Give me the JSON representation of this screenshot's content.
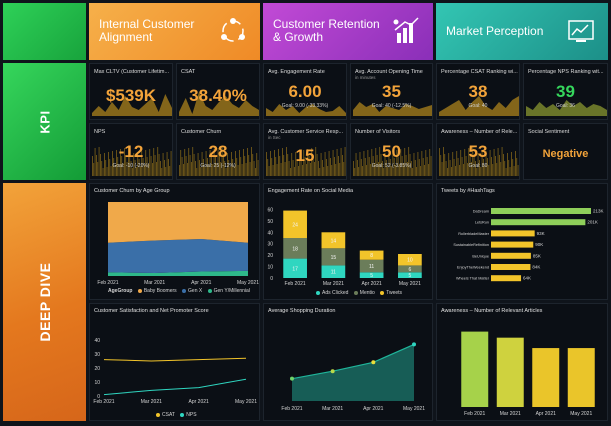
{
  "sections": {
    "kpi_label": "KPI",
    "deep_dive_label": "DEEP DIVE"
  },
  "banners": [
    {
      "label": "Internal Customer Alignment",
      "icon": "team-circle-icon",
      "color": "#ef8a26"
    },
    {
      "label": "Customer Retention & Growth",
      "icon": "growth-bars-icon",
      "color": "#8a2fb8"
    },
    {
      "label": "Market Perception",
      "icon": "chart-screen-icon",
      "color": "#1c8f88"
    }
  ],
  "kpis": [
    {
      "title": "Max CLTV (Customer Lifetim...",
      "value": "$539K",
      "goal": ""
    },
    {
      "title": "CSAT",
      "value": "38.40%",
      "goal": ""
    },
    {
      "title": "Avg. Engagement Rate",
      "value": "6.00",
      "goal": "Goal: 9.00 (-33.33%)"
    },
    {
      "title": "Avg. Account Opening Time",
      "subtitle": "in minutes",
      "value": "35",
      "goal": "Goal: 40 (-12.5%)"
    },
    {
      "title": "Percentage CSAT Ranking wi...",
      "value": "38",
      "goal": "Goal: 40"
    },
    {
      "title": "Percentage NPS Ranking wit...",
      "value": "39",
      "goal": "Goal: 36"
    },
    {
      "title": "NPS",
      "value": "-12",
      "goal": "Goal: -10 (-20%)"
    },
    {
      "title": "Customer Churn",
      "value": "28",
      "goal": "Goal: 25 (-12%)"
    },
    {
      "title": "Avg. Customer Service Resp...",
      "subtitle": "in Sec",
      "value": "15",
      "goal": ""
    },
    {
      "title": "Number of Visitors",
      "value": "50",
      "goal": "Goal: 52 (-3.85%)"
    },
    {
      "title": "Awareness – Number of Rele...",
      "value": "53",
      "goal": "Goal: 80"
    },
    {
      "title": "Social Sentiment",
      "value": "Negative",
      "goal": ""
    }
  ],
  "panels": {
    "churn_by_age": {
      "title": "Customer Churn by Age Group",
      "legend_title": "AgeGroup"
    },
    "engagement_social": {
      "title": "Engagement Rate on Social Media"
    },
    "tweets_hashtags": {
      "title": "Tweets by #HashTags"
    },
    "csat_nps": {
      "title": "Customer Satisfaction and Net Promoter Score"
    },
    "shopping_duration": {
      "title": "Average Shopping Duration"
    },
    "awareness_articles": {
      "title": "Awareness – Number of Relevant Articles"
    }
  },
  "chart_data": [
    {
      "id": "churn_by_age",
      "type": "area",
      "stacked": true,
      "categories": [
        "Feb 2021",
        "Mar 2021",
        "Apr 2021",
        "May 2021"
      ],
      "series": [
        {
          "name": "Baby Boomers",
          "color": "#f0a94a",
          "values": [
            55,
            52,
            50,
            55
          ]
        },
        {
          "name": "Gen X",
          "color": "#3a6fa8",
          "values": [
            40,
            44,
            44,
            38
          ]
        },
        {
          "name": "Gen Y/Millennial",
          "color": "#2eb88a",
          "values": [
            5,
            4,
            6,
            7
          ]
        }
      ]
    },
    {
      "id": "engagement_social",
      "type": "bar",
      "stacked": true,
      "categories": [
        "Feb 2021",
        "Mar 2021",
        "Apr 2021",
        "May 2021"
      ],
      "ylim": [
        0,
        70
      ],
      "yticks": [
        0,
        10,
        20,
        30,
        40,
        50,
        60
      ],
      "series": [
        {
          "name": "Ads Clicked",
          "color": "#2fd6c0",
          "values": [
            17,
            11,
            5,
            5
          ]
        },
        {
          "name": "Mentio",
          "color": "#6b7d5a",
          "values": [
            18,
            15,
            11,
            6
          ]
        },
        {
          "name": "Tweets",
          "color": "#f2c42a",
          "values": [
            24,
            14,
            8,
            10
          ]
        }
      ]
    },
    {
      "id": "tweets_hashtags",
      "type": "bar",
      "orientation": "horizontal",
      "categories": [
        "DaDream",
        "LetsRun",
        "RollerbladeMaster",
        "SustainableRefinition",
        "BeUnique",
        "EnjoyTheWeekend",
        "Wheels That Matter"
      ],
      "values": [
        213,
        201,
        93,
        90,
        85,
        84,
        64
      ],
      "labels": [
        "213K",
        "201K",
        "93K",
        "90K",
        "85K",
        "84K",
        "64K"
      ],
      "colors": [
        "#8fcf5a",
        "#8fcf5a",
        "#f2c42a",
        "#f2c42a",
        "#f2c42a",
        "#f2c42a",
        "#f2c42a"
      ]
    },
    {
      "id": "csat_nps",
      "type": "line",
      "categories": [
        "Feb 2021",
        "Mar 2021",
        "Apr 2021",
        "May 2021"
      ],
      "ylim": [
        0,
        50
      ],
      "yticks": [
        0,
        10,
        20,
        30,
        40
      ],
      "series": [
        {
          "name": "CSAT",
          "color": "#f2c42a",
          "values": [
            26,
            25,
            26,
            27
          ]
        },
        {
          "name": "NPS",
          "color": "#2fd6c0",
          "values": [
            1,
            4,
            6,
            12
          ]
        }
      ]
    },
    {
      "id": "shopping_duration",
      "type": "area",
      "categories": [
        "Feb 2021",
        "Mar 2021",
        "Apr 2021",
        "May 2021"
      ],
      "series": [
        {
          "name": "Duration",
          "color": "#1fb59a",
          "values": [
            15,
            20,
            26,
            38
          ]
        }
      ]
    },
    {
      "id": "awareness_articles",
      "type": "bar",
      "categories": [
        "Feb 2021",
        "Mar 2021",
        "Apr 2021",
        "May 2021"
      ],
      "values": [
        87,
        80,
        68,
        68
      ],
      "colors": [
        "#a6d24a",
        "#cfd23e",
        "#eac52a",
        "#eac52a"
      ]
    }
  ]
}
